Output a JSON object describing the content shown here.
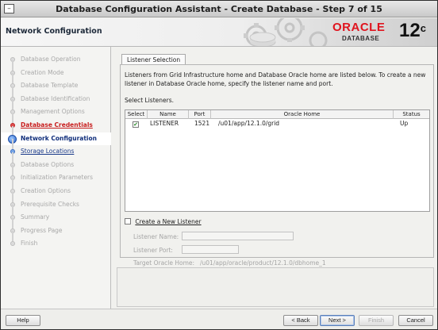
{
  "window": {
    "title": "Database Configuration Assistant - Create Database - Step 7 of 15"
  },
  "header": {
    "page_title": "Network Configuration",
    "logo_brand": "ORACLE",
    "logo_sub": "DATABASE",
    "version_number": "12",
    "version_suffix": "c"
  },
  "steps": [
    {
      "label": "Database Operation",
      "state": "done"
    },
    {
      "label": "Creation Mode",
      "state": "done"
    },
    {
      "label": "Database Template",
      "state": "done"
    },
    {
      "label": "Database Identification",
      "state": "done"
    },
    {
      "label": "Management Options",
      "state": "done"
    },
    {
      "label": "Database Credentials",
      "state": "error"
    },
    {
      "label": "Network Configuration",
      "state": "current"
    },
    {
      "label": "Storage Locations",
      "state": "link"
    },
    {
      "label": "Database Options",
      "state": "pending"
    },
    {
      "label": "Initialization Parameters",
      "state": "pending"
    },
    {
      "label": "Creation Options",
      "state": "pending"
    },
    {
      "label": "Prerequisite Checks",
      "state": "pending"
    },
    {
      "label": "Summary",
      "state": "pending"
    },
    {
      "label": "Progress Page",
      "state": "pending"
    },
    {
      "label": "Finish",
      "state": "pending"
    }
  ],
  "content": {
    "tab_label": "Listener Selection",
    "description": "Listeners from Grid Infrastructure home and Database Oracle home are listed below. To create a new listener in Database Oracle home, specify the listener name and port.",
    "select_label": "Select Listeners.",
    "table": {
      "headers": [
        "Select",
        "Name",
        "Port",
        "Oracle Home",
        "Status"
      ],
      "rows": [
        {
          "selected": "✔",
          "name": "LISTENER",
          "port": "1521",
          "home": "/u01/app/12.1.0/grid",
          "status": "Up"
        }
      ]
    },
    "new_listener": {
      "checkbox_label": "Create a New Listener",
      "name_label": "Listener Name:",
      "port_label": "Listener Port:",
      "home_label": "Target Oracle Home:",
      "home_value": "/u01/app/oracle/product/12.1.0/dbhome_1"
    }
  },
  "footer": {
    "help": "Help",
    "back": "< Back",
    "next": "Next >",
    "finish": "Finish",
    "cancel": "Cancel"
  }
}
